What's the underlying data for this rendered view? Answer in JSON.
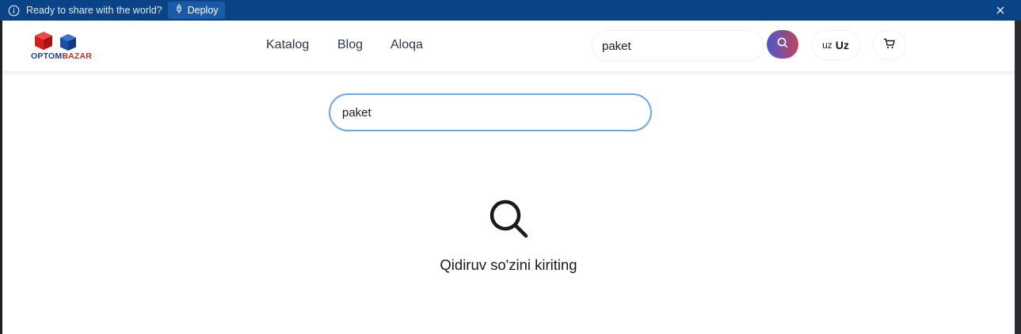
{
  "banner": {
    "message": "Ready to share with the world?",
    "deploy_label": "Deploy",
    "background": "#0a4487"
  },
  "header": {
    "logo": {
      "part1": "OPTOM",
      "part2": "BAZAR"
    },
    "nav": [
      {
        "label": "Katalog"
      },
      {
        "label": "Blog"
      },
      {
        "label": "Aloqa"
      }
    ],
    "search": {
      "value": "paket"
    },
    "language": {
      "code": "uz",
      "label": "Uz"
    }
  },
  "main": {
    "search": {
      "value": "paket"
    },
    "empty_message": "Qidiruv so'zini kiriting"
  },
  "icons": {
    "banner_info": "info-icon",
    "deploy": "rocket-icon",
    "close": "close-icon",
    "search": "search-icon",
    "cart": "cart-icon"
  },
  "colors": {
    "search_gradient_start": "#4a58c8",
    "search_gradient_end": "#c0455e",
    "input_focus_border": "#6ea6e6"
  }
}
